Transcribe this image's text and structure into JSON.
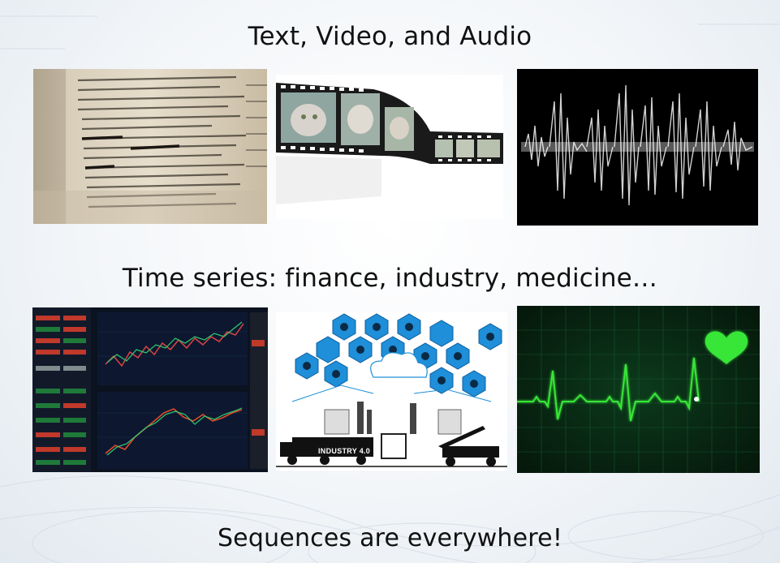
{
  "slide": {
    "title_top": "Text, Video, and Audio",
    "title_mid": "Time series: finance, industry, medicine…",
    "title_bottom": "Sequences are everywhere!"
  },
  "images": {
    "text_image": "dictionary-page-image",
    "video_image": "film-strip-cat-image",
    "audio_image": "audio-waveform-image",
    "finance_image": "stock-chart-image",
    "industry_image": "industry-4-hexagon-image",
    "medicine_image": "ecg-heartbeat-image",
    "industry_truck_label": "INDUSTRY 4.0"
  },
  "colors": {
    "ecg_green": "#39e639",
    "industry_blue": "#1e8fd8",
    "audio_bg": "#000000"
  }
}
